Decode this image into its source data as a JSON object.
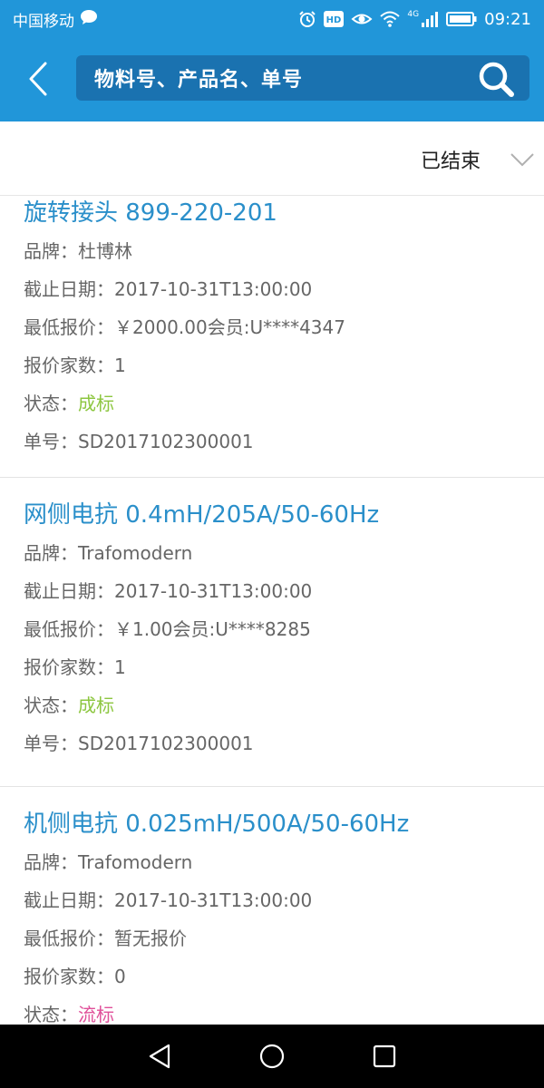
{
  "status_bar": {
    "carrier": "中国移动",
    "time": "09:21",
    "network": "4G",
    "hd": "HD"
  },
  "header": {
    "search_placeholder": "物料号、产品名、单号"
  },
  "filter": {
    "selected": "已结束"
  },
  "items": [
    {
      "title": "旋转接头 899-220-201",
      "brand_label": "品牌：",
      "brand": "杜博林",
      "deadline_label": "截止日期：",
      "deadline": "2017-10-31T13:00:00",
      "price_label": "最低报价：",
      "price": "￥2000.00会员:U****4347",
      "count_label": "报价家数：",
      "count": "1",
      "status_label": "状态：",
      "status": "成标",
      "order_label": "单号：",
      "order": "SD2017102300001"
    },
    {
      "title": "网侧电抗  0.4mH/205A/50-60Hz",
      "brand_label": "品牌：",
      "brand": "Trafomodern",
      "deadline_label": "截止日期：",
      "deadline": "2017-10-31T13:00:00",
      "price_label": "最低报价：",
      "price": "￥1.00会员:U****8285",
      "count_label": "报价家数：",
      "count": "1",
      "status_label": "状态：",
      "status": "成标",
      "order_label": "单号：",
      "order": "SD2017102300001"
    },
    {
      "title": "机侧电抗  0.025mH/500A/50-60Hz",
      "brand_label": "品牌：",
      "brand": "Trafomodern",
      "deadline_label": "截止日期：",
      "deadline": "2017-10-31T13:00:00",
      "price_label": "最低报价：",
      "price": "暂无报价",
      "count_label": "报价家数：",
      "count": "0",
      "status_label": "状态：",
      "status": "流标"
    }
  ],
  "colors": {
    "primary": "#2196d9",
    "search_bg": "#1a72b0",
    "title": "#2a8fca",
    "status_success": "#8cc63f",
    "status_fail": "#e0509a"
  },
  "icons": [
    "message-icon",
    "alarm-icon",
    "hd-icon",
    "eye-icon",
    "wifi-icon",
    "signal-icon",
    "battery-icon",
    "back-arrow-icon",
    "search-icon",
    "chevron-down-icon",
    "nav-back-icon",
    "nav-home-icon",
    "nav-recent-icon"
  ]
}
